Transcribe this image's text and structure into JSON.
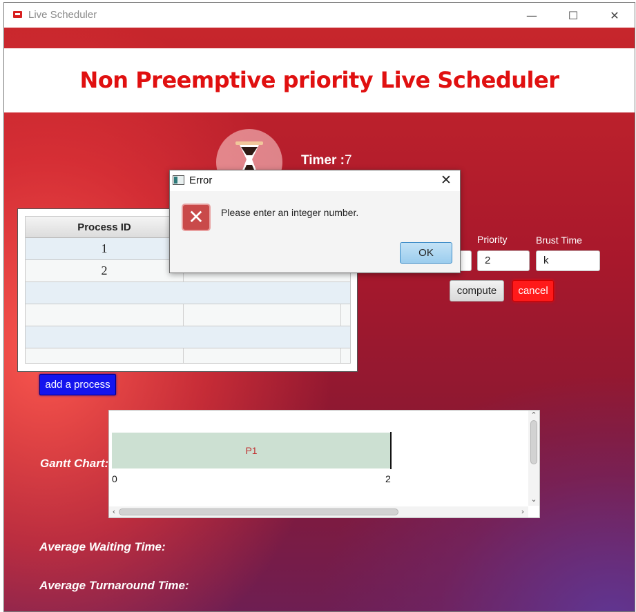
{
  "window": {
    "title": "Live Scheduler",
    "controls": {
      "minimize": "—",
      "maximize": "☐",
      "close": "✕"
    }
  },
  "header": {
    "title": "Non Preemptive priority Live Scheduler"
  },
  "timer": {
    "label": "Timer :",
    "value": "7"
  },
  "table": {
    "columns": [
      "Process ID",
      ""
    ],
    "rows": [
      {
        "process_id": "1",
        "col2": ""
      },
      {
        "process_id": "2",
        "col2": ""
      },
      {
        "process_id": "",
        "col2": ""
      },
      {
        "process_id": "",
        "col2": ""
      },
      {
        "process_id": "",
        "col2": ""
      },
      {
        "process_id": "",
        "col2": ""
      }
    ]
  },
  "form": {
    "priority_label": "Priority",
    "priority_value": "2",
    "burst_label": "Brust Time",
    "burst_value": "k",
    "compute_label": "compute",
    "cancel_label": "cancel"
  },
  "add_process_label": "add a process",
  "gantt": {
    "label": "Gantt Chart:",
    "bars": [
      {
        "name": "P1",
        "start": 0,
        "end": 2
      }
    ],
    "ticks": [
      "0",
      "2"
    ]
  },
  "stats": {
    "avg_waiting_label": "Average Waiting Time:",
    "avg_turnaround_label": "Average Turnaround Time:"
  },
  "dialog": {
    "title": "Error",
    "message": "Please enter an integer number.",
    "ok_label": "OK",
    "close": "✕"
  },
  "colors": {
    "title_red": "#e01010",
    "cancel_red": "#ff1a1a",
    "add_blue": "#1414ee",
    "gantt_bar": "#cce0d2"
  }
}
